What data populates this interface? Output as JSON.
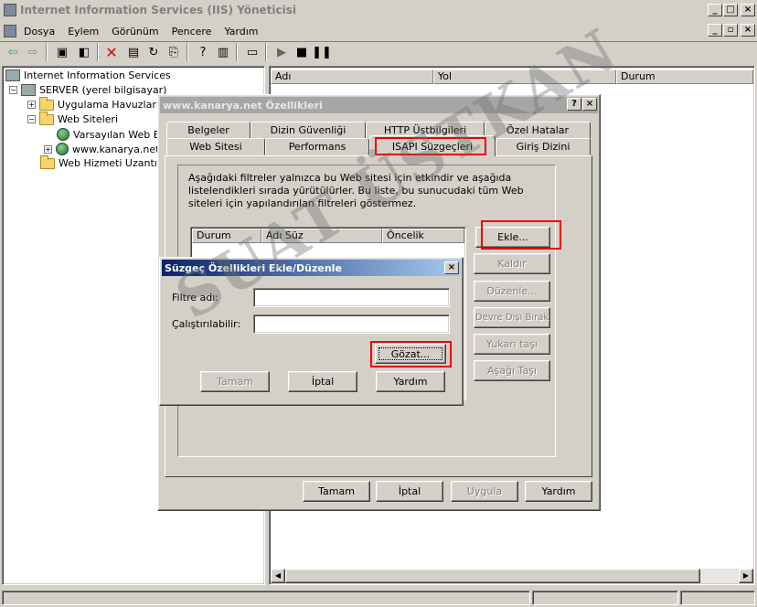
{
  "window": {
    "title": "Internet Information Services (IIS) Yöneticisi"
  },
  "menu": [
    "Dosya",
    "Eylem",
    "Görünüm",
    "Pencere",
    "Yardım"
  ],
  "tree": {
    "root": "Internet Information Services",
    "server": "SERVER (yerel bilgisayar)",
    "app_pools": "Uygulama Havuzları",
    "web_sites": "Web Siteleri",
    "default_site": "Varsayılan Web Bö",
    "kanarya": "www.kanarya.net",
    "extensions": "Web Hizmeti Uzantıları"
  },
  "list_columns": [
    "Adı",
    "Yol",
    "Durum"
  ],
  "props_dialog": {
    "title": "www.kanarya.net Özellikleri",
    "tabs_back": [
      "Belgeler",
      "Dizin Güvenliği",
      "HTTP Üstbilgileri",
      "Özel Hatalar"
    ],
    "tabs_front": [
      "Web Sitesi",
      "Performans",
      "ISAPI Süzgeçleri",
      "Giriş Dizini"
    ],
    "description": "Aşağıdaki filtreler yalnızca bu Web sitesi için etkindir ve aşağıda listelendikleri sırada yürütülürler. Bu liste, bu sunucudaki tüm Web siteleri için yapılandırılan filtreleri göstermez.",
    "filter_columns": [
      "Durum",
      "Adı Süz",
      "Öncelik"
    ],
    "side_buttons": [
      "Ekle...",
      "Kaldır",
      "Düzenle...",
      "Devre Dışı Bırak",
      "Yukarı taşı",
      "Aşağı Taşı"
    ],
    "bottom_buttons": [
      "Tamam",
      "İptal",
      "Uygula",
      "Yardım"
    ]
  },
  "filter_dialog": {
    "title": "Süzgeç Özellikleri Ekle/Düzenle",
    "filter_name_label": "Filtre adı:",
    "filter_name_value": "",
    "executable_label": "Çalıştırılabilir:",
    "executable_value": "",
    "browse_button": "Gözat...",
    "ok": "Tamam",
    "cancel": "İptal",
    "help": "Yardım"
  },
  "watermark": "SUAT ÜSTKAN",
  "colors": {
    "highlight": "#e00000",
    "title_active": "#0a246a",
    "title_inactive": "#808080"
  }
}
